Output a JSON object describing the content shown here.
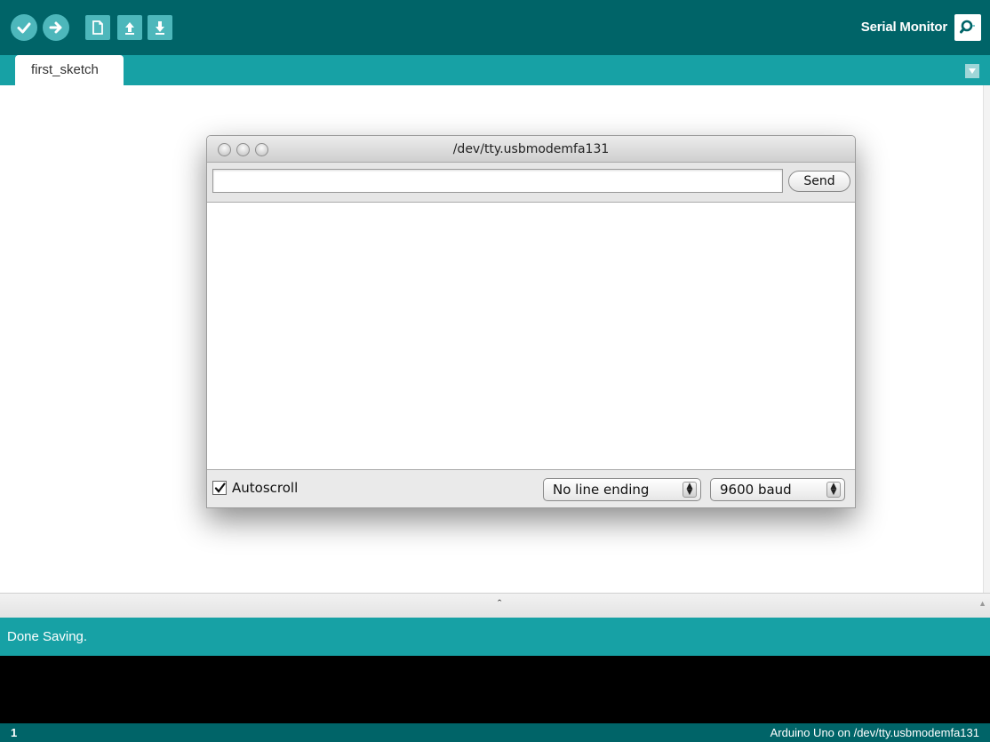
{
  "toolbar": {
    "title": "Serial Monitor",
    "buttons": [
      {
        "name": "verify",
        "icon": "check-icon"
      },
      {
        "name": "upload",
        "icon": "arrow-right-icon"
      },
      {
        "name": "new",
        "icon": "new-file-icon"
      },
      {
        "name": "open",
        "icon": "open-upload-arrow-icon"
      },
      {
        "name": "save",
        "icon": "save-download-arrow-icon"
      }
    ],
    "serial_icon": "magnifier-icon"
  },
  "tabs": [
    {
      "label": "first_sketch",
      "active": true
    }
  ],
  "tab_menu_icon": "triangle-down-icon",
  "serial_monitor": {
    "title": "/dev/tty.usbmodemfa131",
    "input_value": "",
    "send_label": "Send",
    "output_text": "",
    "autoscroll_label": "Autoscroll",
    "autoscroll_checked": true,
    "line_ending": "No line ending",
    "baud": "9600 baud"
  },
  "status": {
    "message": "Done Saving."
  },
  "footer": {
    "line_number": "1",
    "board": "Arduino Uno on /dev/tty.usbmodemfa131"
  },
  "colors": {
    "toolbar": "#006468",
    "tabstrip": "#17a1a5",
    "button": "#4db7bb",
    "console": "#000000"
  }
}
